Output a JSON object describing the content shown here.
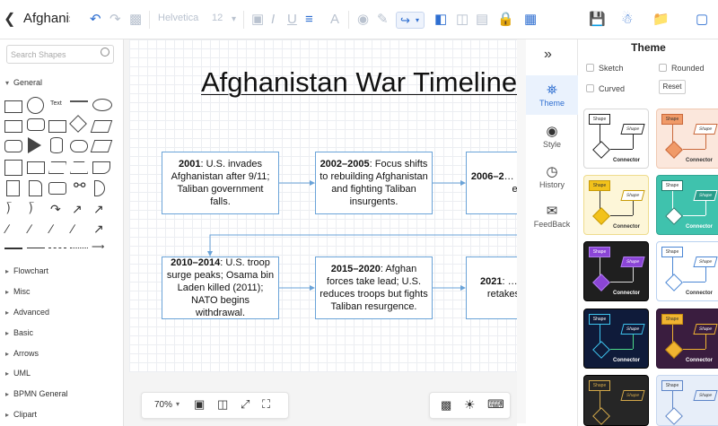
{
  "doc_title": "Afghanis",
  "toolbar": {
    "font_name": "Helvetica",
    "font_size": "12"
  },
  "sidebar": {
    "search_placeholder": "Search Shapes",
    "general_label": "General",
    "text_shape_label": "Text",
    "sections": [
      "Flowchart",
      "Misc",
      "Advanced",
      "Basic",
      "Arrows",
      "UML",
      "BPMN General",
      "Clipart"
    ]
  },
  "canvas": {
    "title": "Afghanistan War Timeline",
    "nodes": [
      {
        "year": "2001",
        "text": ": U.S. invades Afghanistan after 9/11; Taliban government falls."
      },
      {
        "year": "2002–2005",
        "text": ": Focus shifts to rebuilding Afghanistan and fighting Taliban insurgents."
      },
      {
        "year": "2006–2",
        "text": "… regains stre… esc…"
      },
      {
        "year": "2010–2014",
        "text": ": U.S. troop surge peaks; Osama bin Laden killed (2011); NATO begins withdrawal."
      },
      {
        "year": "2015–2020",
        "text": ": Afghan forces take lead; U.S. reduces troops but fights Taliban resurgence."
      },
      {
        "year": "2021",
        "text": ": … withdraw… retakes… Afgh…"
      }
    ]
  },
  "zoom": {
    "value": "70%"
  },
  "nav": {
    "items": [
      {
        "label": "Theme",
        "icon": "shirt-icon"
      },
      {
        "label": "Style",
        "icon": "palette-icon"
      },
      {
        "label": "History",
        "icon": "clock-icon"
      },
      {
        "label": "FeedBack",
        "icon": "chat-icon"
      }
    ]
  },
  "panel": {
    "title": "Theme",
    "options": {
      "sketch": "Sketch",
      "rounded": "Rounded",
      "curved": "Curved",
      "reset": "Reset"
    },
    "card_shape": "Shape",
    "card_connector": "Connector"
  },
  "colors": {
    "accent": "#2f6fd1",
    "node_border": "#6aa3d8"
  }
}
